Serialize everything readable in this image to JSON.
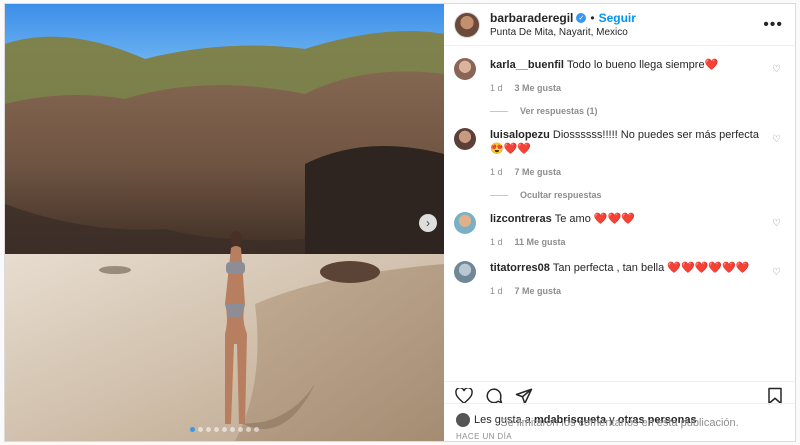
{
  "header": {
    "username": "barbaraderegil",
    "separator": "•",
    "follow_label": "Seguir",
    "location": "Punta De Mita, Nayarit, Mexico",
    "more_label": "•••"
  },
  "comments": [
    {
      "user": "karla__buenfil",
      "text": "Todo lo bueno llega siempre❤️",
      "time": "1 d",
      "likes": "3 Me gusta",
      "avatar_color": "#b98e7c",
      "replies_label": "Ver respuestas (1)"
    },
    {
      "user": "luisalopezu",
      "text": "Diossssss!!!!! No puedes ser más perfecta 😍❤️❤️",
      "time": "1 d",
      "likes": "7 Me gusta",
      "avatar_color": "#6d5850",
      "replies_label": "Ocultar respuestas"
    },
    {
      "user": "lizcontreras",
      "text": "Te amo ❤️❤️❤️",
      "time": "1 d",
      "likes": "11 Me gusta",
      "avatar_color": "#d08a5e"
    },
    {
      "user": "titatorres08",
      "text": "Tan perfecta , tan bella ❤️❤️❤️❤️❤️❤️",
      "time": "1 d",
      "likes": "7 Me gusta",
      "avatar_color": "#8ea0b0"
    }
  ],
  "icons": {
    "heart": "heart-icon",
    "comment": "comment-icon",
    "share": "share-icon",
    "save": "bookmark-icon"
  },
  "likes_summary": {
    "prefix": "Les gusta a",
    "user": "mdabrisqueta",
    "connector": "y",
    "others": "otras personas"
  },
  "posted_ago": "HACE UN DÍA",
  "comments_limited": "Se limitaron los comentarios en esta publicación.",
  "carousel": {
    "next_label": "›",
    "count": 9,
    "active": 0
  },
  "colors": {
    "link": "#0095f6",
    "verified": "#3897f0",
    "heart": "#ed4956"
  }
}
